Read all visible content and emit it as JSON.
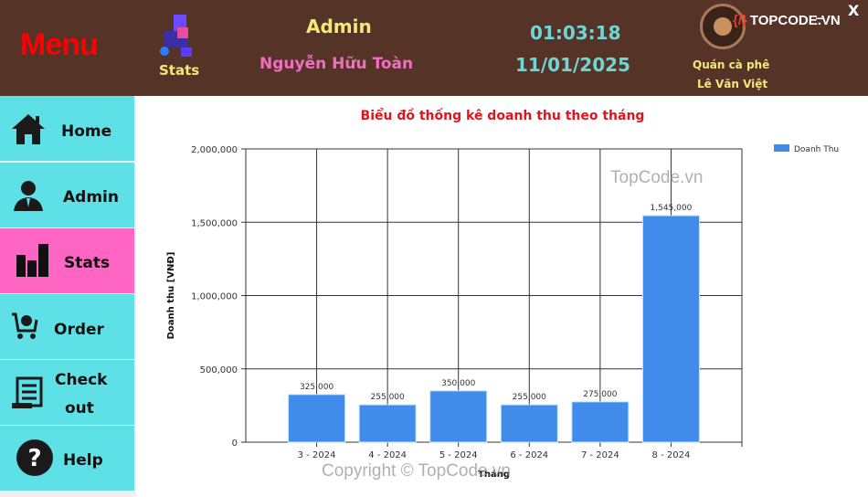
{
  "header": {
    "menu_title": "Menu",
    "stats_label": "Stats",
    "role": "Admin",
    "user_name": "Nguyễn Hữu Toàn",
    "time": "01:03:18",
    "date": "11/01/2025",
    "shop_line1": "Quán cà phê",
    "shop_line2": "Lê Văn Việt",
    "minimize": "_",
    "close": "X",
    "logo_text": "TOPCODE.VN"
  },
  "sidebar": {
    "items": [
      {
        "label": "Home",
        "icon": "home-icon",
        "active": false
      },
      {
        "label": "Admin",
        "icon": "admin-icon",
        "active": false
      },
      {
        "label": "Stats",
        "icon": "bar-chart-icon",
        "active": true
      },
      {
        "label": "Order",
        "icon": "cart-icon",
        "active": false
      },
      {
        "label": "Check out",
        "label1": "Check",
        "label2": "out",
        "icon": "receipt-icon",
        "active": false
      },
      {
        "label": "Help",
        "icon": "help-icon",
        "active": false
      }
    ]
  },
  "colors": {
    "header": "#553427",
    "sidebar": "#5ee1e6",
    "active": "#ff66c4",
    "bar": "#418ceb",
    "title": "#e0141e"
  },
  "watermarks": {
    "center": "TopCode.vn",
    "bottom": "Copyright © TopCode.vn"
  },
  "chart_data": {
    "type": "bar",
    "title": "Biểu đồ thống kê doanh thu theo tháng",
    "xlabel": "Tháng",
    "ylabel": "Doanh thu [VNĐ]",
    "categories": [
      "3 - 2024",
      "4 - 2024",
      "5 - 2024",
      "6 - 2024",
      "7 - 2024",
      "8 - 2024"
    ],
    "series": [
      {
        "name": "Doanh Thu",
        "values": [
          325000,
          255000,
          350000,
          255000,
          275000,
          1545000
        ]
      }
    ],
    "data_labels": [
      "325,000",
      "255,000",
      "350,000",
      "255,000",
      "275,000",
      "1,545,000"
    ],
    "ylim": [
      0,
      2000000
    ],
    "yticks": [
      0,
      500000,
      1000000,
      1500000,
      2000000
    ],
    "ytick_labels": [
      "0",
      "500,000",
      "1,000,000",
      "1,500,000",
      "2,000,000"
    ],
    "grid": true,
    "legend": "top-right"
  }
}
